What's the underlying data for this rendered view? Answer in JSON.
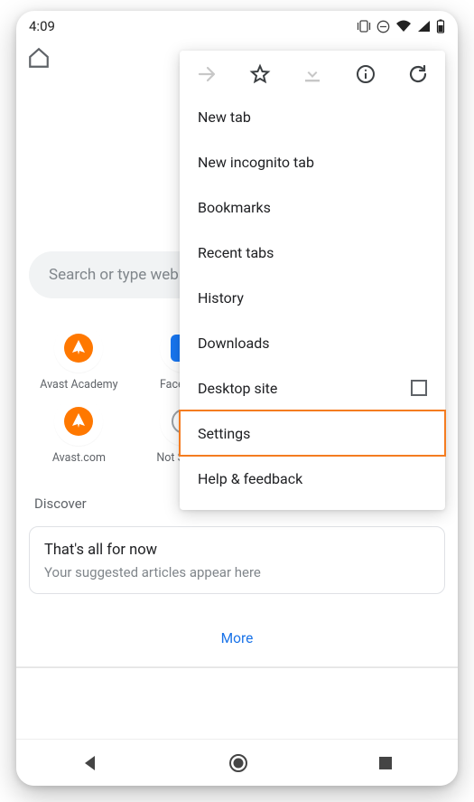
{
  "status": {
    "time": "4:09"
  },
  "search": {
    "placeholder": "Search or type web address"
  },
  "shortcuts": [
    {
      "label": "Avast Academy",
      "icon": "avast"
    },
    {
      "label": "Facebook",
      "icon": "facebook"
    },
    {
      "label": "Avast.com",
      "icon": "avast"
    },
    {
      "label": "Not Secure",
      "icon": "warning"
    }
  ],
  "discover": {
    "heading": "Discover"
  },
  "card": {
    "title": "That's all for now",
    "subtitle": "Your suggested articles appear here"
  },
  "more": {
    "label": "More"
  },
  "menu": {
    "items": {
      "new_tab": "New tab",
      "new_incognito": "New incognito tab",
      "bookmarks": "Bookmarks",
      "recent_tabs": "Recent tabs",
      "history": "History",
      "downloads": "Downloads",
      "desktop_site": "Desktop site",
      "settings": "Settings",
      "help": "Help & feedback"
    }
  },
  "colors": {
    "highlight": "#f47c20",
    "link": "#1a73e8"
  }
}
